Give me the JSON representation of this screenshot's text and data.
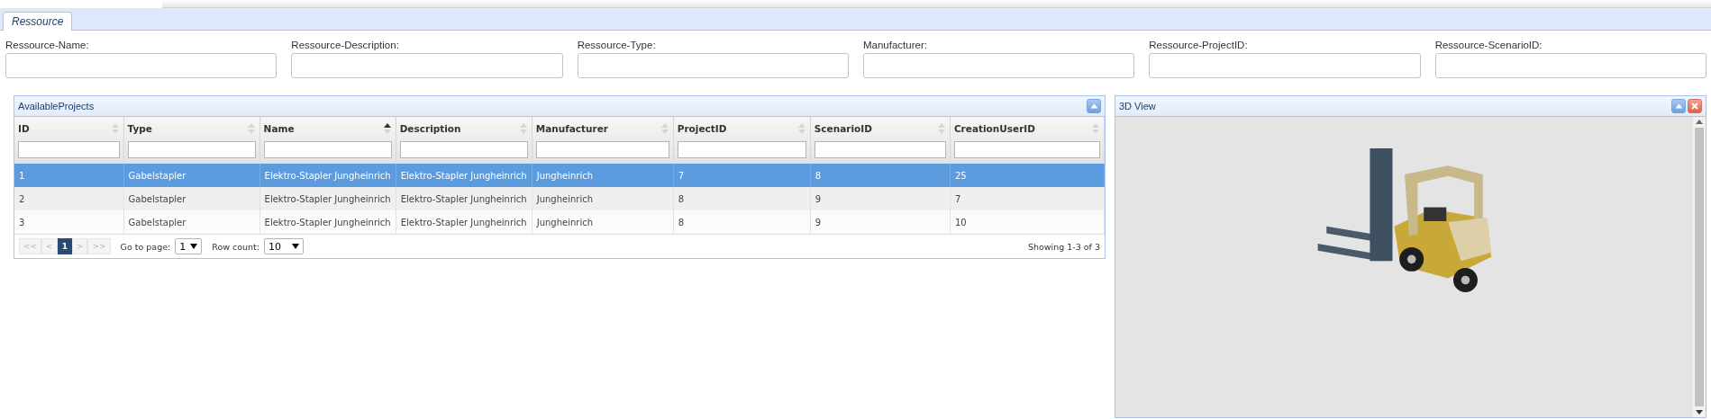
{
  "tabs": [
    {
      "label": "Ressource",
      "selected": true
    }
  ],
  "form_fields": [
    {
      "label": "Ressource-Name:"
    },
    {
      "label": "Ressource-Description:"
    },
    {
      "label": "Ressource-Type:"
    },
    {
      "label": "Manufacturer:"
    },
    {
      "label": "Ressource-ProjectID:"
    },
    {
      "label": "Ressource-ScenarioID:"
    }
  ],
  "projects_panel": {
    "title": "AvailableProjects",
    "columns": [
      {
        "label": "ID",
        "sorted": false
      },
      {
        "label": "Type",
        "sorted": false
      },
      {
        "label": "Name",
        "sorted": true
      },
      {
        "label": "Description",
        "sorted": false
      },
      {
        "label": "Manufacturer",
        "sorted": false
      },
      {
        "label": "ProjectID",
        "sorted": false
      },
      {
        "label": "ScenarioID",
        "sorted": false
      },
      {
        "label": "CreationUserID",
        "sorted": false
      }
    ],
    "rows": [
      {
        "selected": true,
        "cells": [
          "1",
          "Gabelstapler",
          "Elektro-Stapler Jungheinrich",
          "Elektro-Stapler Jungheinrich",
          "Jungheinrich",
          "7",
          "8",
          "25"
        ]
      },
      {
        "selected": false,
        "cells": [
          "2",
          "Gabelstapler",
          "Elektro-Stapler Jungheinrich",
          "Elektro-Stapler Jungheinrich",
          "Jungheinrich",
          "8",
          "9",
          "7"
        ]
      },
      {
        "selected": false,
        "cells": [
          "3",
          "Gabelstapler",
          "Elektro-Stapler Jungheinrich",
          "Elektro-Stapler Jungheinrich",
          "Jungheinrich",
          "8",
          "9",
          "10"
        ]
      }
    ],
    "pager": {
      "buttons": [
        {
          "label": "<<",
          "selected": false,
          "disabled": true
        },
        {
          "label": "<",
          "selected": false,
          "disabled": true
        },
        {
          "label": "1",
          "selected": true,
          "disabled": false
        },
        {
          "label": ">",
          "selected": false,
          "disabled": true
        },
        {
          "label": ">>",
          "selected": false,
          "disabled": true
        }
      ],
      "goto_label": "Go to page:",
      "goto_value": "1",
      "rowcount_label": "Row count:",
      "rowcount_value": "10",
      "summary": "Showing 1-3 of 3"
    }
  },
  "view_panel": {
    "title": "3D View"
  }
}
